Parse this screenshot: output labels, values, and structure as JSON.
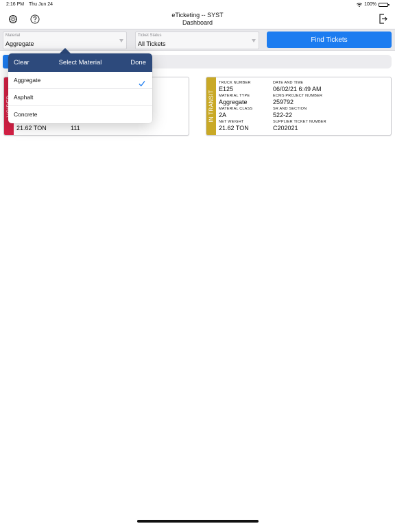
{
  "status_bar": {
    "time": "2:16 PM",
    "date": "Thu Jun 24",
    "battery": "100%"
  },
  "header": {
    "app_title": "eTicketing -- SYST",
    "subtitle": "Dashboard"
  },
  "filters": {
    "material": {
      "label": "Material",
      "value": "Aggregate"
    },
    "ticket_status": {
      "label": "Ticket Status",
      "value": "All Tickets"
    },
    "find_button": "Find Tickets"
  },
  "popover": {
    "clear": "Clear",
    "title": "Select Material",
    "done": "Done",
    "options": [
      {
        "label": "Aggregate",
        "selected": true
      },
      {
        "label": "Asphalt",
        "selected": false
      },
      {
        "label": "Concrete",
        "selected": false
      }
    ]
  },
  "tickets": [
    {
      "status": "VOIDED",
      "status_color": "#d42145",
      "net_weight": "21.62 TON",
      "supplier_ticket_number": "111"
    },
    {
      "status": "IN TRANSIT",
      "status_color": "#c9a926",
      "labels": {
        "truck_number": "TRUCK NUMBER",
        "date_time": "DATE AND TIME",
        "material_type": "MATERIAL TYPE",
        "ecms_project_number": "ECMS PROJECT NUMBER",
        "material_class": "MATERIAL CLASS",
        "sr_section": "SR AND SECTION",
        "net_weight": "NET WEIGHT",
        "supplier_ticket_number": "SUPPLIER TICKET NUMBER"
      },
      "truck_number": "E125",
      "date_time": "06/02/21 6:49 AM",
      "material_type": "Aggregate",
      "ecms_project_number": "259792",
      "material_class": "2A",
      "sr_section": "522-22",
      "net_weight": "21.62 TON",
      "supplier_ticket_number": "C202021"
    }
  ],
  "colors": {
    "accent": "#1c7cf0",
    "popover_header": "#2d4a7c"
  },
  "icons": [
    "gear-icon",
    "help-icon",
    "logout-icon",
    "wifi-icon",
    "battery-icon",
    "checkmark-icon"
  ]
}
